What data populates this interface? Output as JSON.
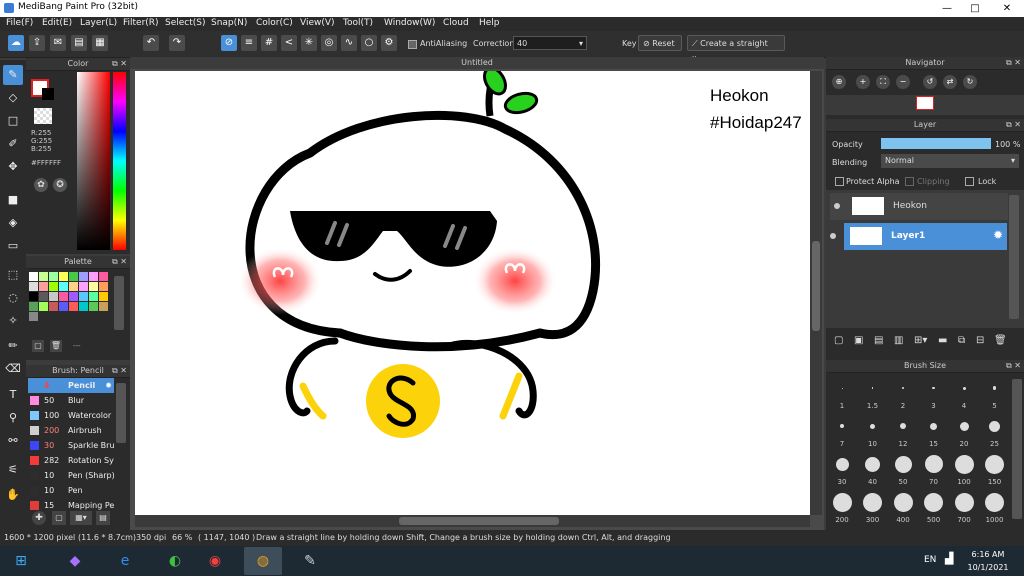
{
  "window": {
    "title": "MediBang Paint Pro (32bit)",
    "min": "—",
    "max": "□",
    "close": "✕"
  },
  "menu": [
    "File(F)",
    "Edit(E)",
    "Layer(L)",
    "Filter(R)",
    "Select(S)",
    "Snap(N)",
    "Color(C)",
    "View(V)",
    "Tool(T)",
    "Window(W)",
    "Cloud",
    "Help"
  ],
  "toolbar": {
    "antialiasing_label": "AntiAliasing",
    "correction_label": "Correction",
    "correction_value": "40",
    "key_label": "Key",
    "reset_label": "Reset",
    "straight_line_label": "Create a straight line"
  },
  "color_panel": {
    "title": "Color",
    "r": "R:255",
    "g": "G:255",
    "b": "B:255",
    "hex": "#FFFFFF"
  },
  "palette_panel": {
    "title": "Palette",
    "more": "---"
  },
  "brush_panel": {
    "title": "Brush: Pencil",
    "brushes": [
      {
        "size": "4",
        "name": "Pencil",
        "color": "#4a90d9"
      },
      {
        "size": "50",
        "name": "Blur",
        "color": "#ff8be0"
      },
      {
        "size": "100",
        "name": "Watercolor",
        "color": "#7ec8ff"
      },
      {
        "size": "200",
        "name": "Airbrush",
        "color": "#cfcfcf"
      },
      {
        "size": "30",
        "name": "Sparkle Brush",
        "color": "#3b47f5"
      },
      {
        "size": "282",
        "name": "Rotation Sym",
        "color": "#f23b3b"
      },
      {
        "size": "10",
        "name": "Pen (Sharp)",
        "color": "#2d2d2d"
      },
      {
        "size": "10",
        "name": "Pen",
        "color": "#2d2d2d"
      },
      {
        "size": "15",
        "name": "Mapping Pen",
        "color": "#e23b3b"
      }
    ]
  },
  "document": {
    "tab": "Untitled",
    "watermark_line1": "Heokon",
    "watermark_line2": "#Hoidap247"
  },
  "navigator": {
    "title": "Navigator"
  },
  "layer_panel": {
    "title": "Layer",
    "opacity_label": "Opacity",
    "opacity_value": "100 %",
    "opacity_fraction": 1.0,
    "blending_label": "Blending",
    "blending_value": "Normal",
    "protect_alpha": "Protect Alpha",
    "clipping": "Clipping",
    "lock": "Lock",
    "layers": [
      {
        "name": "Heokon",
        "selected": false
      },
      {
        "name": "Layer1",
        "selected": true
      }
    ]
  },
  "brush_size_panel": {
    "title": "Brush Size",
    "sizes": [
      "1",
      "1.5",
      "2",
      "3",
      "4",
      "5",
      "7",
      "10",
      "12",
      "15",
      "20",
      "25",
      "30",
      "40",
      "50",
      "70",
      "100",
      "150",
      "200",
      "300",
      "400",
      "500",
      "700",
      "1000"
    ]
  },
  "status": {
    "dimensions": "1600 * 1200 pixel",
    "physical": "(11.6 * 8.7cm)",
    "dpi": "350 dpi",
    "zoom": "66 %",
    "coords": "( 1147, 1040 )",
    "hint": "Draw a straight line by holding down Shift, Change a brush size by holding down Ctrl, Alt, and dragging"
  },
  "taskbar": {
    "lang": "EN",
    "time": "6:16 AM",
    "date": "10/1/2021"
  },
  "colors": {
    "accent": "#4a90d9",
    "smiley_yellow": "#fcd20a",
    "leaf_green": "#27d11e",
    "blush_red": "#ff4a4a"
  }
}
